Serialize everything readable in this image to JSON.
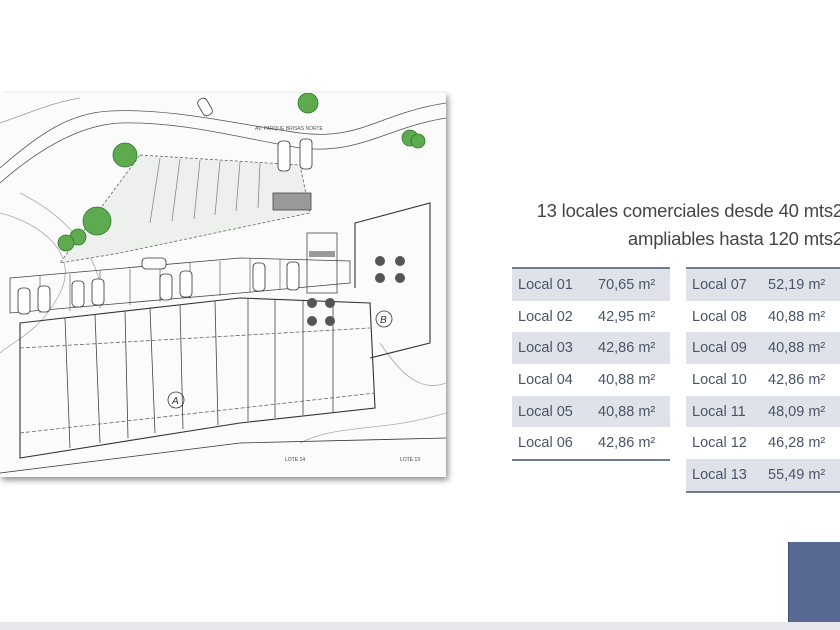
{
  "plan": {
    "labels": {
      "street": "AV. PARQUE BRISAS NORTE",
      "block_a": "A",
      "block_b": "B",
      "lote_14": "LOTE 14",
      "lote_13": "LOTE 13"
    }
  },
  "heading": {
    "line1": "13 locales comerciales desde 40 mts2",
    "line2": "ampliables hasta 120 mts2"
  },
  "table_left": [
    {
      "name": "Local 01",
      "area": "70,65 m²"
    },
    {
      "name": "Local 02",
      "area": "42,95 m²"
    },
    {
      "name": "Local 03",
      "area": "42,86 m²"
    },
    {
      "name": "Local 04",
      "area": "40,88 m²"
    },
    {
      "name": "Local 05",
      "area": "40,88 m²"
    },
    {
      "name": "Local 06",
      "area": "42,86 m²"
    }
  ],
  "table_right": [
    {
      "name": "Local 07",
      "area": "52,19 m²"
    },
    {
      "name": "Local 08",
      "area": "40,88 m²"
    },
    {
      "name": "Local 09",
      "area": "40,88 m²"
    },
    {
      "name": "Local 10",
      "area": "42,86 m²"
    },
    {
      "name": "Local 11",
      "area": "48,09 m²"
    },
    {
      "name": "Local 12",
      "area": "46,28 m²"
    },
    {
      "name": "Local 13",
      "area": "55,49 m²"
    }
  ],
  "colors": {
    "accent": "#566a94",
    "row_shade": "#dfe2e9",
    "tree": "#3f9a3a"
  }
}
